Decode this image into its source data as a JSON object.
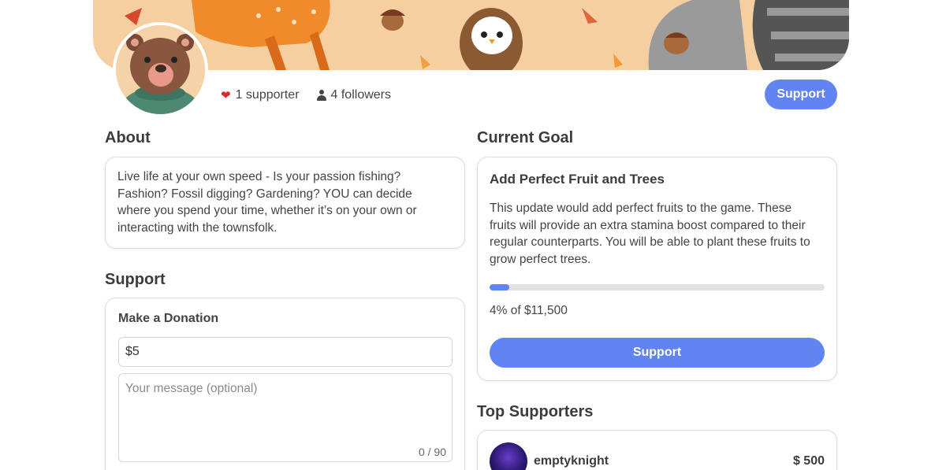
{
  "profile": {
    "supporters_count": "1 supporter",
    "followers_count": "4 followers",
    "support_button_label": "Support"
  },
  "about": {
    "title": "About",
    "text": "Live life at your own speed - Is your passion fishing? Fashion? Fossil digging? Gardening? YOU can decide where you spend your time, whether it’s on your own or interacting with the townsfolk."
  },
  "support": {
    "title": "Support",
    "donation_title": "Make a Donation",
    "amount_value": "$5",
    "message_placeholder": "Your message (optional)",
    "char_count": "0 / 90"
  },
  "goal": {
    "section_title": "Current Goal",
    "title": "Add Perfect Fruit and Trees",
    "description": "This update would add perfect fruits to the game. These fruits will provide an extra stamina boost compared to their regular counterparts. You will be able to plant these fruits to grow perfect trees.",
    "progress_percent": 4,
    "progress_text": "4% of $11,500",
    "support_button_label": "Support"
  },
  "top_supporters": {
    "title": "Top Supporters",
    "items": [
      {
        "name": "emptyknight",
        "amount": "$ 500"
      }
    ]
  },
  "colors": {
    "accent": "#6184f2",
    "banner": "#f5cfa0",
    "heart": "#e02424"
  }
}
